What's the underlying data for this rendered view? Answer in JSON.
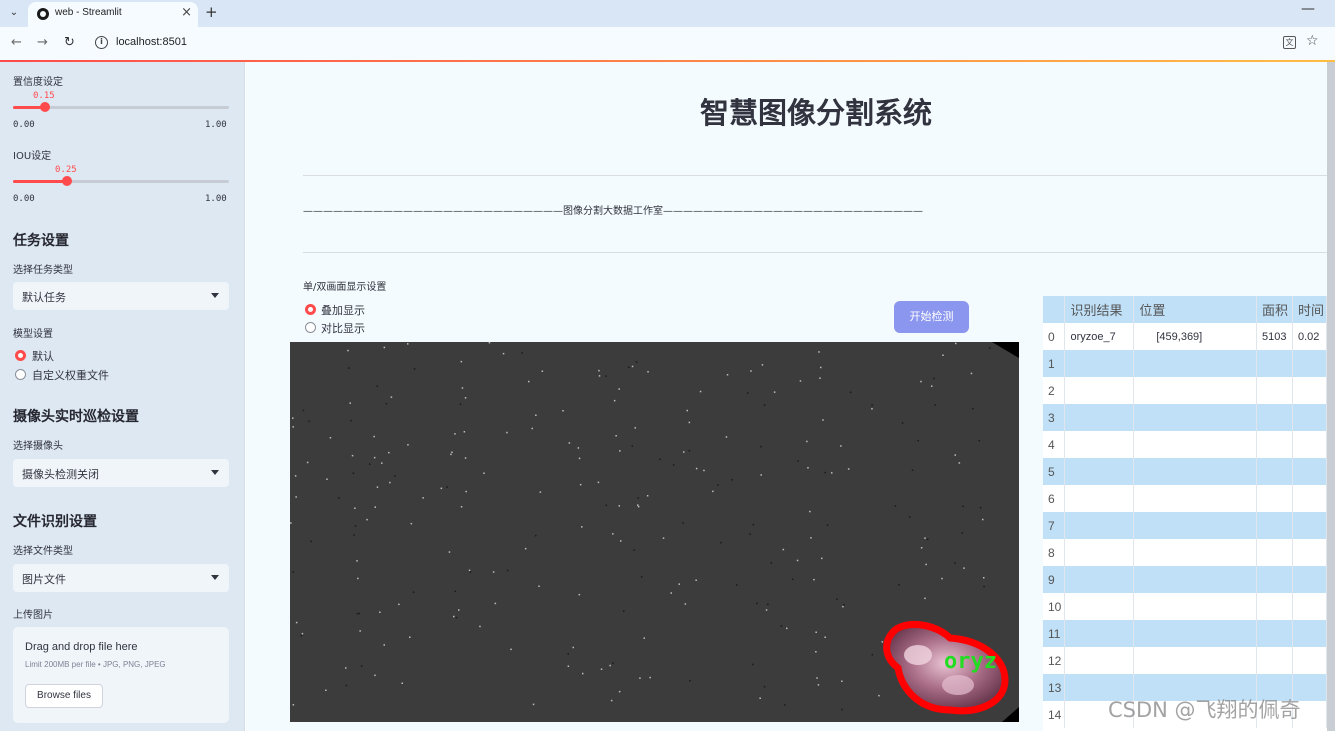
{
  "browser": {
    "tab_title": "web - Streamlit",
    "url": "localhost:8501"
  },
  "sidebar": {
    "confidence": {
      "label": "置信度设定",
      "value": "0.15",
      "value_num": 0.15,
      "min": "0.00",
      "max": "1.00"
    },
    "iou": {
      "label": "IOU设定",
      "value": "0.25",
      "value_num": 0.25,
      "min": "0.00",
      "max": "1.00"
    },
    "task_section": {
      "title": "任务设置",
      "select_label": "选择任务类型",
      "selected": "默认任务"
    },
    "model": {
      "label": "模型设置",
      "options": [
        "默认",
        "自定义权重文件"
      ],
      "selected_index": 0
    },
    "camera_section": {
      "title": "摄像头实时巡检设置",
      "select_label": "选择摄像头",
      "selected": "摄像头检测关闭"
    },
    "file_section": {
      "title": "文件识别设置",
      "select_label": "选择文件类型",
      "selected": "图片文件"
    },
    "upload": {
      "label": "上传图片",
      "drop_text": "Drag and drop file here",
      "limit_text": "Limit 200MB per file • JPG, PNG, JPEG",
      "browse_label": "Browse files"
    }
  },
  "main": {
    "title": "智慧图像分割系统",
    "banner": "——————————————————————————图像分割大数据工作室——————————————————————————",
    "display_mode": {
      "label": "单/双画面显示设置",
      "options": [
        "叠加显示",
        "对比显示"
      ],
      "selected_index": 0
    },
    "start_button": "开始检测",
    "detection_label": "oryz"
  },
  "table": {
    "columns": [
      "",
      "识别结果",
      "位置",
      "面积",
      "时间"
    ],
    "rows": [
      [
        "0",
        "oryzoe_7",
        "[459,369]",
        "5103",
        "0.02"
      ],
      [
        "1",
        "",
        "",
        "",
        ""
      ],
      [
        "2",
        "",
        "",
        "",
        ""
      ],
      [
        "3",
        "",
        "",
        "",
        ""
      ],
      [
        "4",
        "",
        "",
        "",
        ""
      ],
      [
        "5",
        "",
        "",
        "",
        ""
      ],
      [
        "6",
        "",
        "",
        "",
        ""
      ],
      [
        "7",
        "",
        "",
        "",
        ""
      ],
      [
        "8",
        "",
        "",
        "",
        ""
      ],
      [
        "9",
        "",
        "",
        "",
        ""
      ],
      [
        "10",
        "",
        "",
        "",
        ""
      ],
      [
        "11",
        "",
        "",
        "",
        ""
      ],
      [
        "12",
        "",
        "",
        "",
        ""
      ],
      [
        "13",
        "",
        "",
        "",
        ""
      ],
      [
        "14",
        "",
        "",
        "",
        ""
      ]
    ]
  },
  "watermark": "CSDN @飞翔的佩奇",
  "colors": {
    "accent": "#ff4b4b",
    "button": "#8b96ef",
    "sidebar_bg": "#dde8f3",
    "table_stripe": "#bfe0f7",
    "mask_outline": "#ff0000",
    "label_green": "#22dd22"
  }
}
